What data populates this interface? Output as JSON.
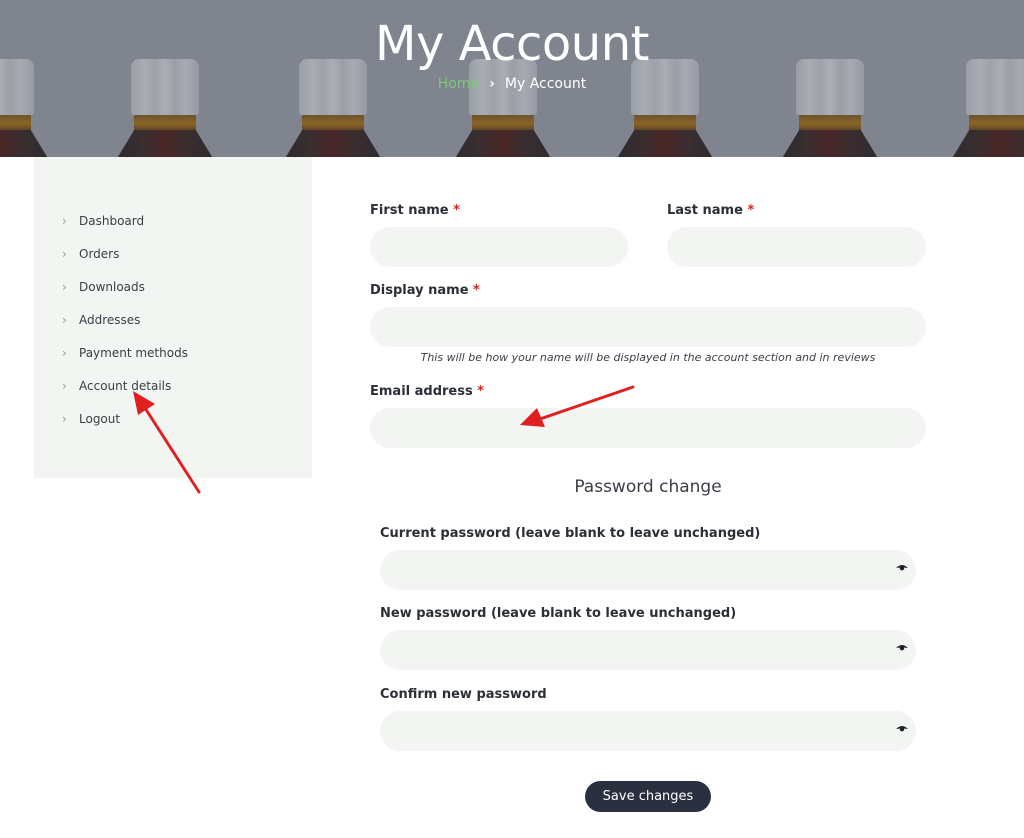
{
  "header": {
    "title": "My Account",
    "breadcrumb": {
      "home": "Home",
      "separator": "›",
      "current": "My Account"
    },
    "accent_color": "#7fc77a"
  },
  "sidebar": {
    "items": [
      {
        "label": "Dashboard",
        "icon": "chevron-right-icon"
      },
      {
        "label": "Orders",
        "icon": "chevron-right-icon"
      },
      {
        "label": "Downloads",
        "icon": "chevron-right-icon"
      },
      {
        "label": "Addresses",
        "icon": "chevron-right-icon"
      },
      {
        "label": "Payment methods",
        "icon": "chevron-right-icon"
      },
      {
        "label": "Account details",
        "icon": "chevron-right-icon"
      },
      {
        "label": "Logout",
        "icon": "chevron-right-icon"
      }
    ],
    "chevron": "›"
  },
  "form": {
    "first_name": {
      "label": "First name",
      "required_mark": "*",
      "value": ""
    },
    "last_name": {
      "label": "Last name",
      "required_mark": "*",
      "value": ""
    },
    "display_name": {
      "label": "Display name",
      "required_mark": "*",
      "value": "",
      "hint": "This will be how your name will be displayed in the account section and in reviews"
    },
    "email": {
      "label": "Email address",
      "required_mark": "*",
      "value": ""
    },
    "password_section_title": "Password change",
    "current_password": {
      "label": "Current password (leave blank to leave unchanged)",
      "value": ""
    },
    "new_password": {
      "label": "New password (leave blank to leave unchanged)",
      "value": ""
    },
    "confirm_password": {
      "label": "Confirm new password",
      "value": ""
    },
    "save_label": "Save changes"
  },
  "colors": {
    "required": "#d7261e",
    "input_bg": "#f2f5f1",
    "button_bg": "#2b3040",
    "annotation_arrow": "#e02020"
  },
  "annotations": [
    {
      "type": "arrow",
      "points_to": "sidebar-item-account-details"
    },
    {
      "type": "arrow",
      "points_to": "email-input"
    }
  ]
}
